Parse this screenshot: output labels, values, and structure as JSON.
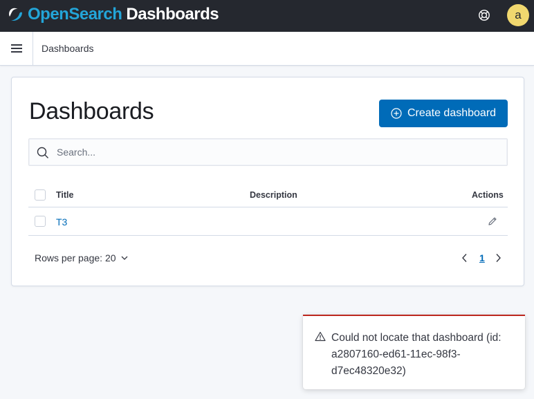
{
  "header": {
    "brand_part1": "Open",
    "brand_part2": "Search",
    "brand_part3": "Dashboards",
    "avatar_initial": "a",
    "brand_color": "#23a5d8",
    "background": "#25282f",
    "help_icon": "help-lifebuoy-icon"
  },
  "breadcrumb": {
    "items": [
      "Dashboards"
    ],
    "menu_icon": "hamburger-menu-icon"
  },
  "page": {
    "title": "Dashboards",
    "create_button_label": "Create dashboard",
    "create_button_icon": "plus-in-circle-icon",
    "search_placeholder": "Search...",
    "search_value": ""
  },
  "table": {
    "columns": [
      "Title",
      "Description",
      "Actions"
    ],
    "rows": [
      {
        "title": "T3",
        "description": "",
        "action_icon": "pencil-edit-icon"
      }
    ]
  },
  "pagination": {
    "rows_per_page_label": "Rows per page: 20",
    "current_page": "1"
  },
  "toast": {
    "message": "Could not locate that dashboard (id: a2807160-ed61-11ec-98f3-d7ec48320e32)",
    "type": "warning",
    "accent_color": "#bd271e"
  },
  "colors": {
    "primary_button": "#006bb8",
    "link": "#006bb8"
  }
}
